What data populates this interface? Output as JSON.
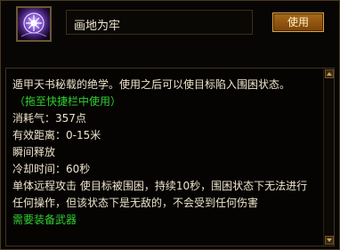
{
  "skill": {
    "name": "画地为牢",
    "icon": "skill-icon-purple-sigil",
    "use_label": "使用"
  },
  "description": {
    "lines": [
      "遁甲天书秘载的绝学。使用之后可以使目标陷入围困状态。",
      "（拖至快捷栏中使用）",
      "消耗气：357点",
      "有效距离：0-15米",
      "瞬间释放",
      "冷却时间：60秒",
      "单体远程攻击 使目标被围困，持续10秒，围困状态下无法进行",
      "任何操作，但该状态下是无敌的，不会受到任何伤害",
      "需要装备武器"
    ]
  },
  "colors": {
    "accent_green": "#2fd02f",
    "text": "#efe4cc",
    "button": "#8a5510"
  }
}
